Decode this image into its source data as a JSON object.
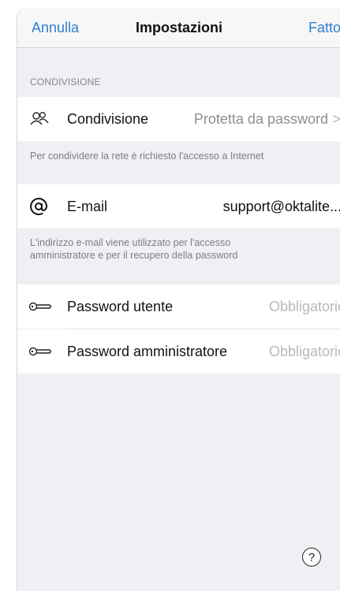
{
  "navbar": {
    "cancel_label": "Annulla",
    "title": "Impostazioni",
    "done_label": "Fatto"
  },
  "sharing_section": {
    "header": "CONDIVISIONE",
    "row": {
      "icon": "people-icon",
      "label": "Condivisione",
      "value": "Protetta da password",
      "chevron": ">"
    },
    "footer": "Per condividere la rete è richiesto l'accesso a Internet"
  },
  "email_section": {
    "row": {
      "icon": "at-sign-icon",
      "label": "E-mail",
      "value": "support@oktalite...."
    },
    "footer_line1": "L'indirizzo e-mail viene utilizzato per l'accesso",
    "footer_line2": "amministratore e per il recupero della password"
  },
  "password_section": {
    "rows": [
      {
        "icon": "key-icon",
        "label": "Password utente",
        "placeholder": "Obbligatorio"
      },
      {
        "icon": "key-icon",
        "label": "Password amministratore",
        "placeholder": "Obbligatorio"
      }
    ]
  },
  "help_button": {
    "icon": "help-icon",
    "label": "?"
  },
  "colors": {
    "accent": "#2f7fd0",
    "background": "#efeff4",
    "placeholder": "#b8b8bd"
  }
}
